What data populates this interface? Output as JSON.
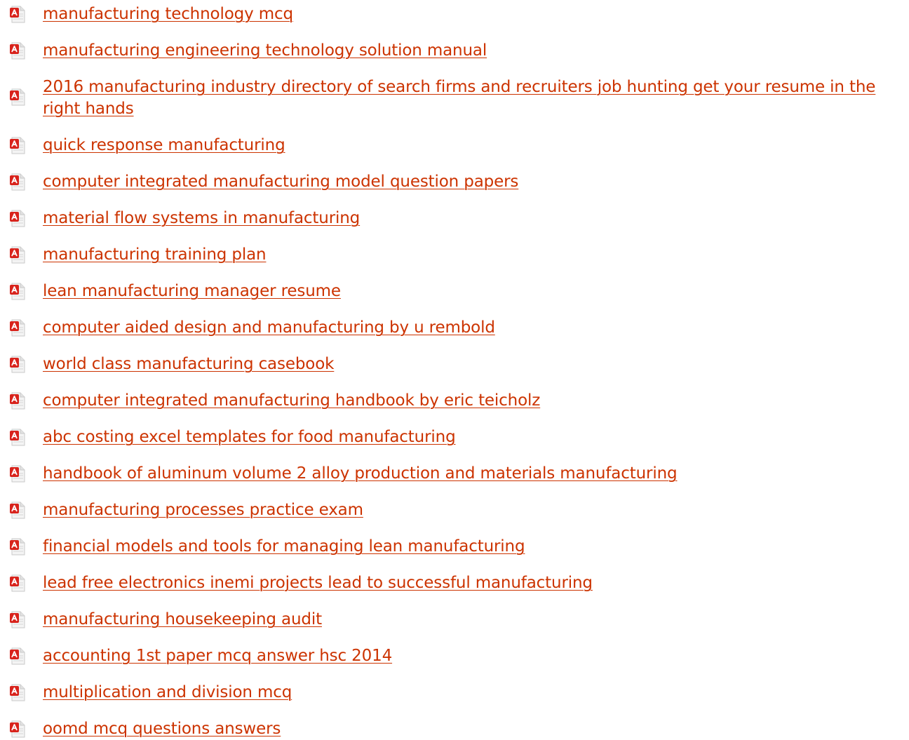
{
  "documents": {
    "items": [
      {
        "label": "manufacturing technology mcq",
        "icon": "pdf-file-icon"
      },
      {
        "label": "manufacturing engineering technology solution manual",
        "icon": "pdf-file-icon"
      },
      {
        "label": "2016 manufacturing industry directory of search firms and recruiters job hunting get your resume in the right hands",
        "icon": "pdf-file-icon"
      },
      {
        "label": "quick response manufacturing",
        "icon": "pdf-file-icon"
      },
      {
        "label": "computer integrated manufacturing model question papers",
        "icon": "pdf-file-icon"
      },
      {
        "label": "material flow systems in manufacturing",
        "icon": "pdf-file-icon"
      },
      {
        "label": "manufacturing training plan",
        "icon": "pdf-file-icon"
      },
      {
        "label": "lean manufacturing manager resume",
        "icon": "pdf-file-icon"
      },
      {
        "label": "computer aided design and manufacturing by u rembold",
        "icon": "pdf-file-icon"
      },
      {
        "label": "world class manufacturing casebook",
        "icon": "pdf-file-icon"
      },
      {
        "label": "computer integrated manufacturing handbook by eric teicholz",
        "icon": "pdf-file-icon"
      },
      {
        "label": "abc costing excel templates for food manufacturing",
        "icon": "pdf-file-icon"
      },
      {
        "label": "handbook of aluminum volume 2 alloy production and materials manufacturing",
        "icon": "pdf-file-icon"
      },
      {
        "label": "manufacturing processes practice exam",
        "icon": "pdf-file-icon"
      },
      {
        "label": "financial models and tools for managing lean manufacturing",
        "icon": "pdf-file-icon"
      },
      {
        "label": "lead free electronics inemi projects lead to successful manufacturing",
        "icon": "pdf-file-icon"
      },
      {
        "label": "manufacturing housekeeping audit",
        "icon": "pdf-file-icon"
      },
      {
        "label": "accounting 1st paper mcq answer hsc 2014",
        "icon": "pdf-file-icon"
      },
      {
        "label": "multiplication and division mcq",
        "icon": "pdf-file-icon"
      },
      {
        "label": "oomd mcq questions answers",
        "icon": "pdf-file-icon"
      }
    ]
  },
  "colors": {
    "link": "#cc3300",
    "icon_red": "#d8231c",
    "icon_page": "#c9c9c9"
  }
}
